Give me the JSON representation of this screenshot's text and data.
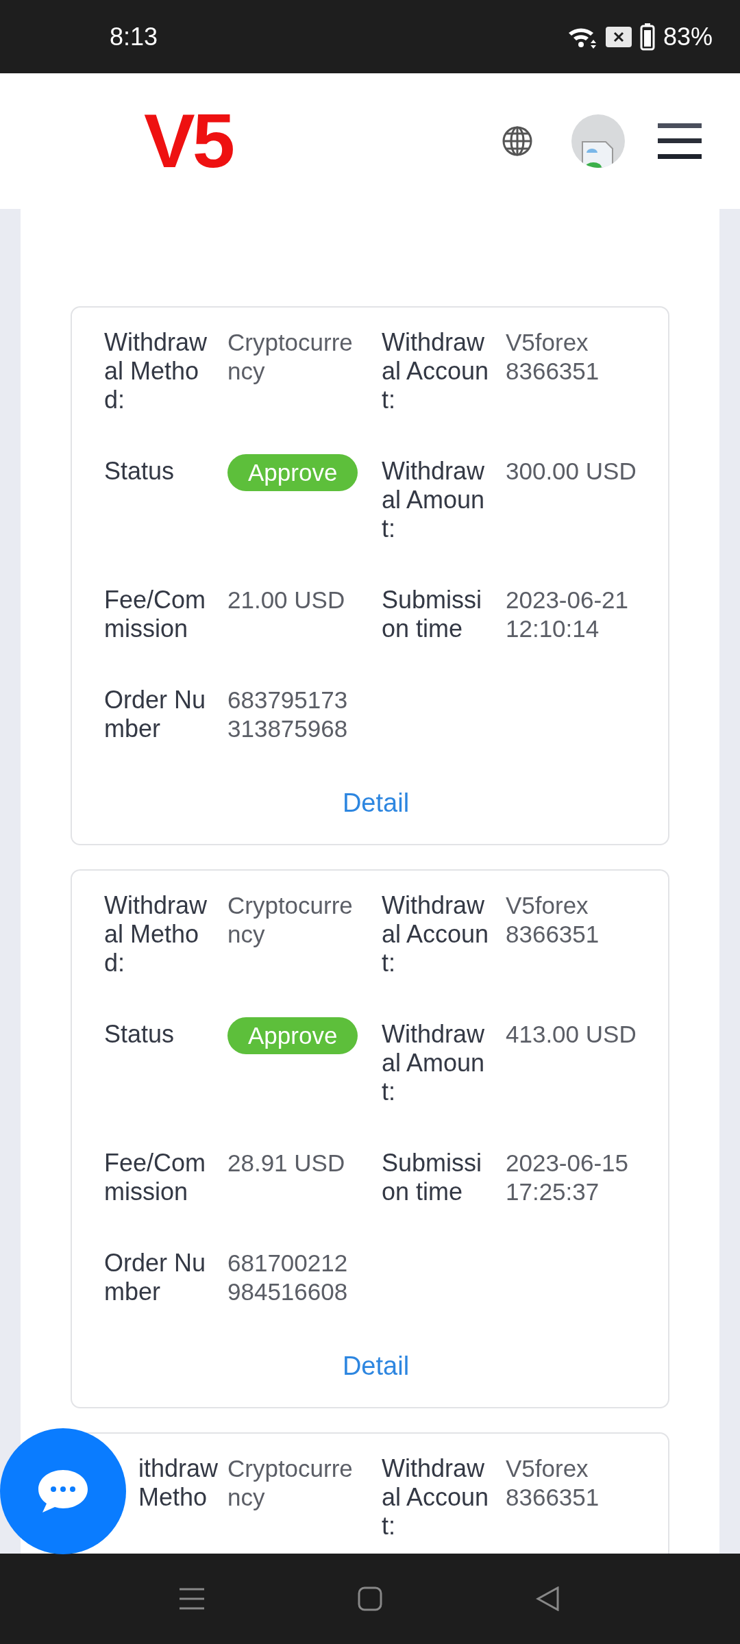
{
  "status_bar": {
    "time": "8:13",
    "battery": "83%"
  },
  "header": {
    "logo": "V5"
  },
  "records": [
    {
      "fields": [
        {
          "kind": "text",
          "label": "Withdrawal Method:",
          "value": "Cryptocurrency"
        },
        {
          "kind": "text",
          "label": "Withdrawal Account:",
          "value": "V5forex 8366351"
        },
        {
          "kind": "badge",
          "label": "Status",
          "value": "Approve",
          "color": "#5dbf3b"
        },
        {
          "kind": "text",
          "label": "Withdrawal Amount:",
          "value": "300.00 USD"
        },
        {
          "kind": "text",
          "label": "Fee/Commission",
          "value": "21.00 USD"
        },
        {
          "kind": "text",
          "label": "Submission time",
          "value": "2023-06-21 12:10:14"
        },
        {
          "kind": "text",
          "label": "Order Number",
          "value": "683795173313875968"
        }
      ],
      "detail": "Detail"
    },
    {
      "fields": [
        {
          "kind": "text",
          "label": "Withdrawal Method:",
          "value": "Cryptocurrency"
        },
        {
          "kind": "text",
          "label": "Withdrawal Account:",
          "value": "V5forex 8366351"
        },
        {
          "kind": "badge",
          "label": "Status",
          "value": "Approve",
          "color": "#5dbf3b"
        },
        {
          "kind": "text",
          "label": "Withdrawal Amount:",
          "value": "413.00 USD"
        },
        {
          "kind": "text",
          "label": "Fee/Commission",
          "value": "28.91 USD"
        },
        {
          "kind": "text",
          "label": "Submission time",
          "value": "2023-06-15 17:25:37"
        },
        {
          "kind": "text",
          "label": "Order Number",
          "value": "681700212984516608"
        }
      ],
      "detail": "Detail"
    },
    {
      "fields": [
        {
          "kind": "covered",
          "label": "ithdraw\nMetho",
          "value": "Cryptocurrency"
        },
        {
          "kind": "text",
          "label": "Withdrawal Account:",
          "value": "V5forex 8366351"
        }
      ]
    }
  ]
}
